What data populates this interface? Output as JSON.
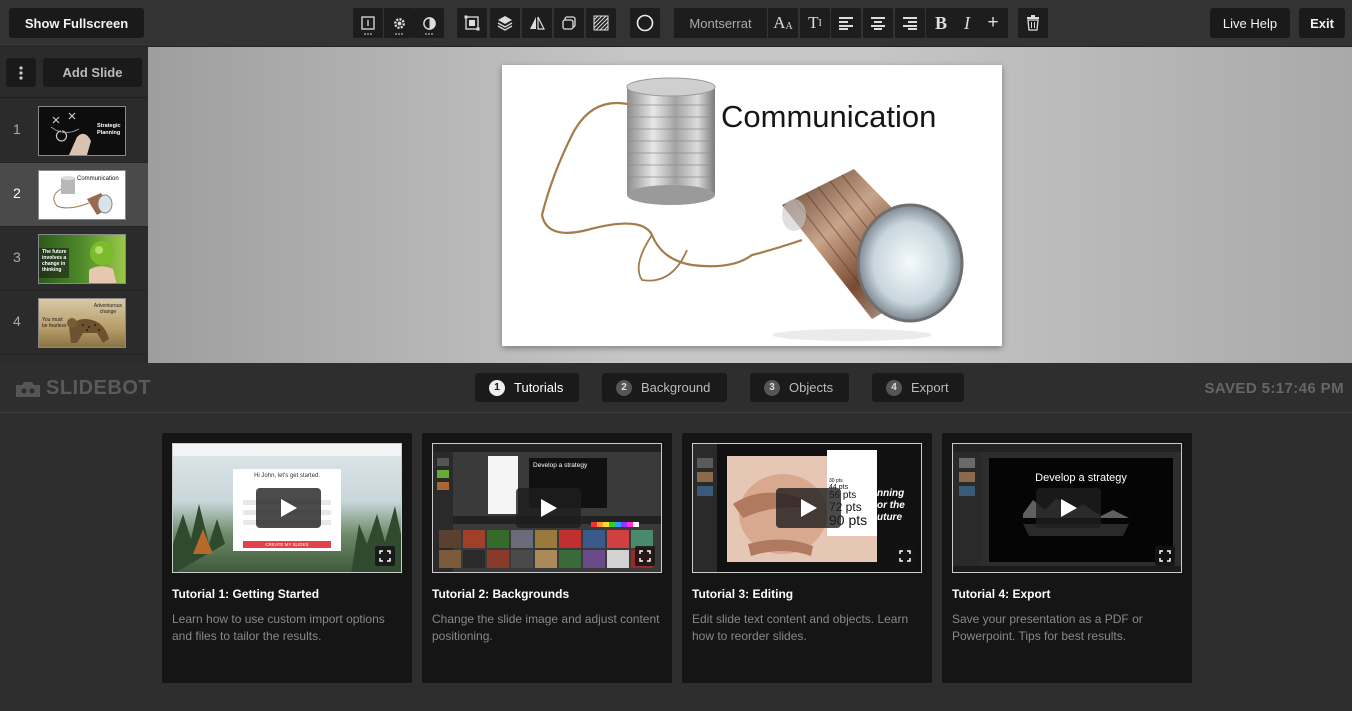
{
  "toolbar": {
    "fullscreen_label": "Show Fullscreen",
    "font_name": "Montserrat",
    "live_help_label": "Live Help",
    "exit_label": "Exit",
    "icons": [
      "text-box-icon",
      "settings-gear-icon",
      "contrast-icon",
      "image-box-icon",
      "layers-icon",
      "flip-icon",
      "arrange-icon",
      "pattern-icon",
      "circle-shape-icon",
      "font-size-icon",
      "text-height-icon",
      "align-left-icon",
      "align-center-icon",
      "align-right-icon",
      "bold-icon",
      "italic-icon",
      "plus-icon",
      "trash-icon"
    ],
    "glyphs": {
      "bold": "B",
      "italic": "I",
      "plus": "+",
      "font_size": "A",
      "text_height": "T"
    }
  },
  "slide_panel": {
    "add_slide_label": "Add Slide",
    "slides": [
      {
        "number": "1",
        "caption_line1": "Strategic",
        "caption_line2": "Planning",
        "theme": "dark"
      },
      {
        "number": "2",
        "caption": "Communication",
        "theme": "light",
        "active": true
      },
      {
        "number": "3",
        "caption_line1": "The future",
        "caption_line2": "involves a",
        "caption_line3": "change in",
        "caption_line4": "thinking",
        "theme": "green"
      },
      {
        "number": "4",
        "caption_line1": "Adventurous",
        "caption_line2": "change",
        "caption_line3": "You must",
        "caption_line4": "be fearless",
        "theme": "savanna"
      }
    ]
  },
  "canvas": {
    "slide_title": "Communication"
  },
  "bottombar": {
    "logo_text": "SLIDEBOT",
    "tabs": [
      {
        "number": "1",
        "label": "Tutorials",
        "active": true
      },
      {
        "number": "2",
        "label": "Background"
      },
      {
        "number": "3",
        "label": "Objects"
      },
      {
        "number": "4",
        "label": "Export"
      }
    ],
    "saved_status": "SAVED 5:17:46 PM"
  },
  "tutorials": [
    {
      "title": "Tutorial 1: Getting Started",
      "description": "Learn how to use custom import options and files to tailor the results.",
      "preview_heading": "Hi John, let's get started.",
      "preview_button": "CREATE MY SLIDES"
    },
    {
      "title": "Tutorial 2: Backgrounds",
      "description": "Change the slide image and adjust content positioning.",
      "preview_heading": "Develop a strategy"
    },
    {
      "title": "Tutorial 3: Editing",
      "description": "Edit slide text content and objects. Learn how to reorder slides.",
      "preview_sizes": [
        "30 pts",
        "44 pts",
        "56 pts",
        "72 pts",
        "90 pts"
      ],
      "preview_words": [
        "nning",
        "or the",
        "uture"
      ]
    },
    {
      "title": "Tutorial 4: Export",
      "description": "Save your presentation as a PDF or Powerpoint. Tips for best results.",
      "preview_heading": "Develop a strategy"
    }
  ],
  "colors": {
    "toolbar_bg": "#333333",
    "button_bg": "#1a1a1a",
    "panel_bg": "#2b2b2b",
    "active_slide_bg": "#4a4a4a",
    "card_bg": "#151515",
    "create_button_red": "#e0434a"
  }
}
